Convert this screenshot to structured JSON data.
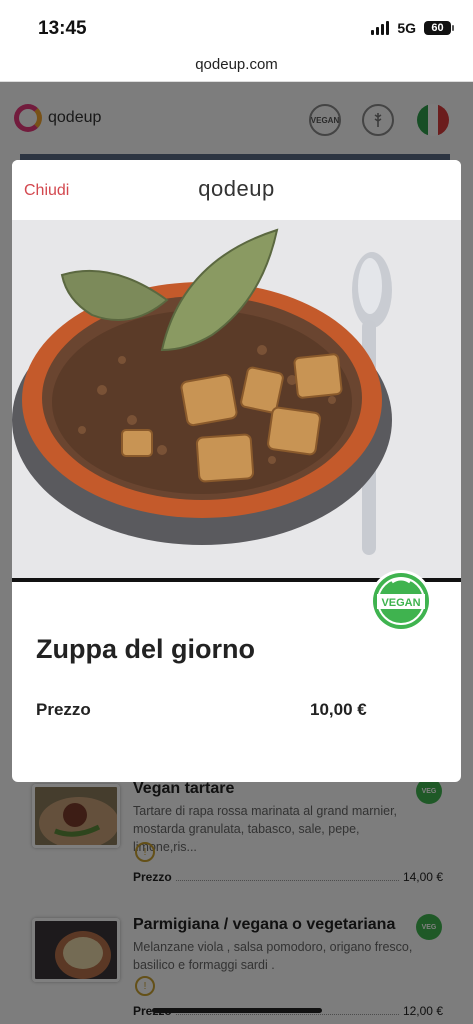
{
  "status_bar": {
    "time": "13:45",
    "network": "5G",
    "battery": "60"
  },
  "browser": {
    "url": "qodeup.com"
  },
  "app": {
    "logo_text": "qodeup",
    "header_icons": [
      "vegan-icon",
      "gluten-free-icon",
      "italian-flag-icon"
    ],
    "vegan_icon_text": "VEGAN"
  },
  "menu_items": [
    {
      "name": "Vegan tartare",
      "description": "Tartare di rapa rossa marinata al grand marnier, mostarda granulata, tabasco, sale, pepe, limone,ris...",
      "price_label": "Prezzo",
      "price": "14,00 €"
    },
    {
      "name": "Parmigiana / vegana o vegetariana",
      "description": "Melanzane viola , salsa pomodoro, origano fresco, basilico e formaggi sardi .",
      "price_label": "Prezzo",
      "price": "12,00 €"
    }
  ],
  "modal": {
    "close_label": "Chiudi",
    "logo_text": "qodeup",
    "badge_text": "VEGAN",
    "dish_name": "Zuppa del giorno",
    "price_label": "Prezzo",
    "price": "10,00 €"
  },
  "colors": {
    "accent_red": "#d3484f",
    "vegan_green": "#3fb34f",
    "logo_pink": "#e4387a",
    "logo_orange": "#f0a32e"
  }
}
